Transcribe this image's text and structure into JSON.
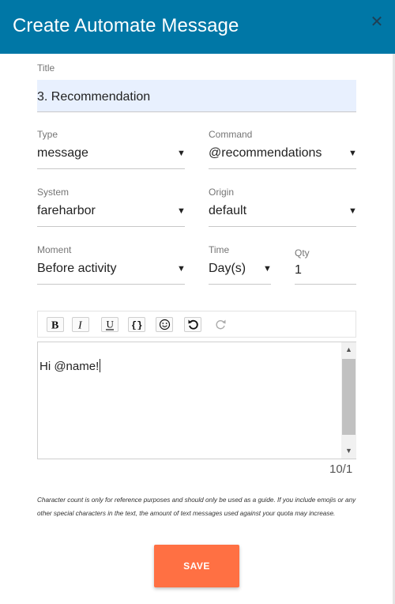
{
  "dialog": {
    "title": "Create Automate Message",
    "close_glyph": "✕"
  },
  "form": {
    "title": {
      "label": "Title",
      "value": "3. Recommendation"
    },
    "type": {
      "label": "Type",
      "value": "message"
    },
    "command": {
      "label": "Command",
      "value": "@recommendations"
    },
    "system": {
      "label": "System",
      "value": "fareharbor"
    },
    "origin": {
      "label": "Origin",
      "value": "default"
    },
    "moment": {
      "label": "Moment",
      "value": "Before activity"
    },
    "time": {
      "label": "Time",
      "value": "Day(s)"
    },
    "qty": {
      "label": "Qty",
      "value": "1"
    },
    "dropdown_arrow": "▼"
  },
  "toolbar": {
    "buttons": [
      {
        "name": "bold-icon"
      },
      {
        "name": "italic-icon"
      },
      {
        "name": "underline-icon"
      },
      {
        "name": "braces-icon"
      },
      {
        "name": "emoji-icon"
      },
      {
        "name": "undo-icon"
      },
      {
        "name": "redo-icon",
        "disabled": true
      }
    ]
  },
  "editor": {
    "text": "Hi @name!",
    "scroll_up": "▲",
    "scroll_down": "▼"
  },
  "char_count": "10/1",
  "note": "Character count is only for reference purposes and should only be used as a guide. If you include emojis or any other special characters in the text, the amount of text messages used against your quota may increase.",
  "save_label": "SAVE",
  "colors": {
    "header": "#0077a6",
    "save_button": "#ff7043",
    "title_field": "#e8f0fe"
  }
}
